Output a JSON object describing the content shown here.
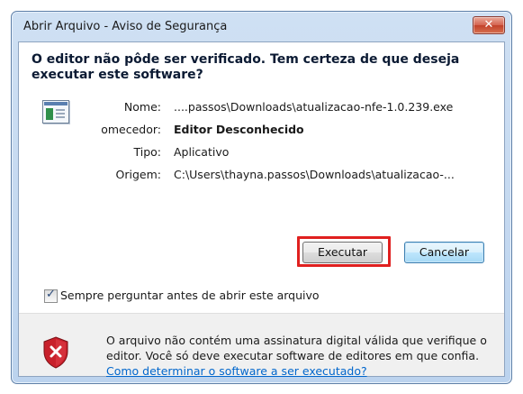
{
  "window": {
    "title": "Abrir Arquivo - Aviso de Segurança",
    "close_glyph": "✕"
  },
  "question": "O editor não pôde ser verificado. Tem certeza de que deseja executar este software?",
  "file_icon": "executable-file-icon",
  "details": [
    {
      "label": "Nome:",
      "value": "....passos\\Downloads\\atualizacao-nfe-1.0.239.exe",
      "bold": false
    },
    {
      "label": "omecedor:",
      "value": "Editor Desconhecido",
      "bold": true
    },
    {
      "label": "Tipo:",
      "value": "Aplicativo",
      "bold": false
    },
    {
      "label": "Origem:",
      "value": "C:\\Users\\thayna.passos\\Downloads\\atualizacao-...",
      "bold": false
    }
  ],
  "buttons": {
    "execute_label": "Executar",
    "cancel_label": "Cancelar"
  },
  "checkbox": {
    "label": "Sempre perguntar antes de abrir este arquivo",
    "checked": true
  },
  "warning": {
    "icon": "shield-error-icon",
    "text": "O arquivo não contém uma assinatura digital válida que verifique o editor. Você só deve executar software de editores em que confia.",
    "link": "Como determinar o software a ser executado?"
  },
  "colors": {
    "highlight": "#e0201f",
    "link": "#0066cc",
    "shield": "#c8202b"
  }
}
